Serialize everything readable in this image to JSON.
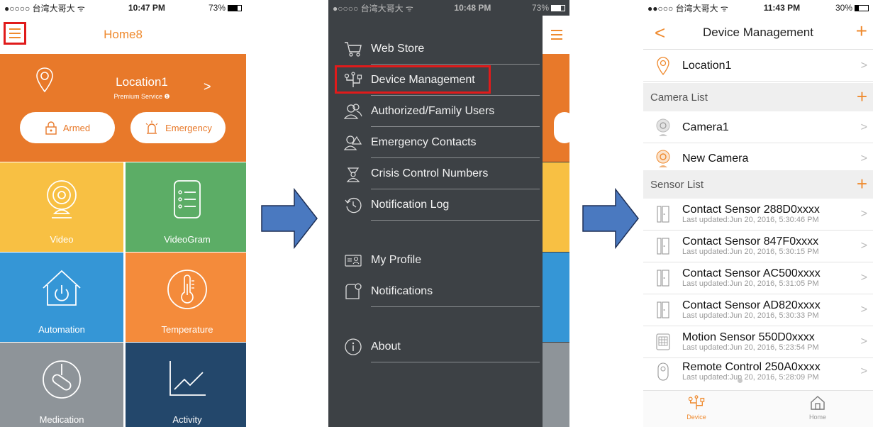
{
  "screen1": {
    "status": {
      "carrier": "●○○○○ 台湾大哥大 ᯤ",
      "time": "10:47 PM",
      "battery": "73%"
    },
    "title": "Home8",
    "location": {
      "name": "Location1",
      "service": "Premium Service ❶",
      "arrow": ">"
    },
    "buttons": {
      "armed": "Armed",
      "emergency": "Emergency"
    },
    "tiles": [
      {
        "label": "Video",
        "color": "#f8c043"
      },
      {
        "label": "VideoGram",
        "color": "#5cad66"
      },
      {
        "label": "Automation",
        "color": "#3596d6"
      },
      {
        "label": "Temperature",
        "color": "#f48b3b"
      },
      {
        "label": "Medication",
        "color": "#8e9499"
      },
      {
        "label": "Activity",
        "color": "#23476b"
      }
    ]
  },
  "screen2": {
    "status": {
      "carrier": "●○○○○ 台湾大哥大 ᯤ",
      "time": "10:48 PM",
      "battery": "73%"
    },
    "menu": [
      {
        "label": "Web Store",
        "icon": "cart-icon"
      },
      {
        "label": "Device Management",
        "icon": "device-icon"
      },
      {
        "label": "Authorized/Family Users",
        "icon": "users-icon"
      },
      {
        "label": "Emergency Contacts",
        "icon": "emergency-contact-icon"
      },
      {
        "label": "Crisis Control Numbers",
        "icon": "crisis-icon"
      },
      {
        "label": "Notification Log",
        "icon": "history-icon"
      },
      {
        "label": "My Profile",
        "icon": "profile-card-icon"
      },
      {
        "label": "Notifications",
        "icon": "notification-icon"
      },
      {
        "label": "About",
        "icon": "info-icon"
      }
    ]
  },
  "screen3": {
    "status": {
      "carrier": "●●○○○ 台湾大哥大 ᯤ",
      "time": "11:43 PM",
      "battery": "30%"
    },
    "title": "Device Management",
    "back": "<",
    "add": "+",
    "location": "Location1",
    "camera_section": "Camera List",
    "cameras": [
      "Camera1",
      "New Camera"
    ],
    "sensor_section": "Sensor List",
    "sensors": [
      {
        "name": "Contact Sensor 288D0xxxx",
        "updated": "Last updated:Jun 20, 2016, 5:30:46 PM"
      },
      {
        "name": "Contact Sensor 847F0xxxx",
        "updated": "Last updated:Jun 20, 2016, 5:30:15 PM"
      },
      {
        "name": "Contact Sensor AC500xxxx",
        "updated": "Last updated:Jun 20, 2016, 5:31:05 PM"
      },
      {
        "name": "Contact Sensor AD820xxxx",
        "updated": "Last updated:Jun 20, 2016, 5:30:33 PM"
      },
      {
        "name": "Motion Sensor 550D0xxxx",
        "updated": "Last updated:Jun 20, 2016, 5:23:54 PM"
      },
      {
        "name": "Remote Control 250A0xxxx",
        "updated": "Last updated:Jun 20, 2016, 5:28:09 PM"
      }
    ],
    "tabs": {
      "device": "Device",
      "home": "Home"
    }
  }
}
